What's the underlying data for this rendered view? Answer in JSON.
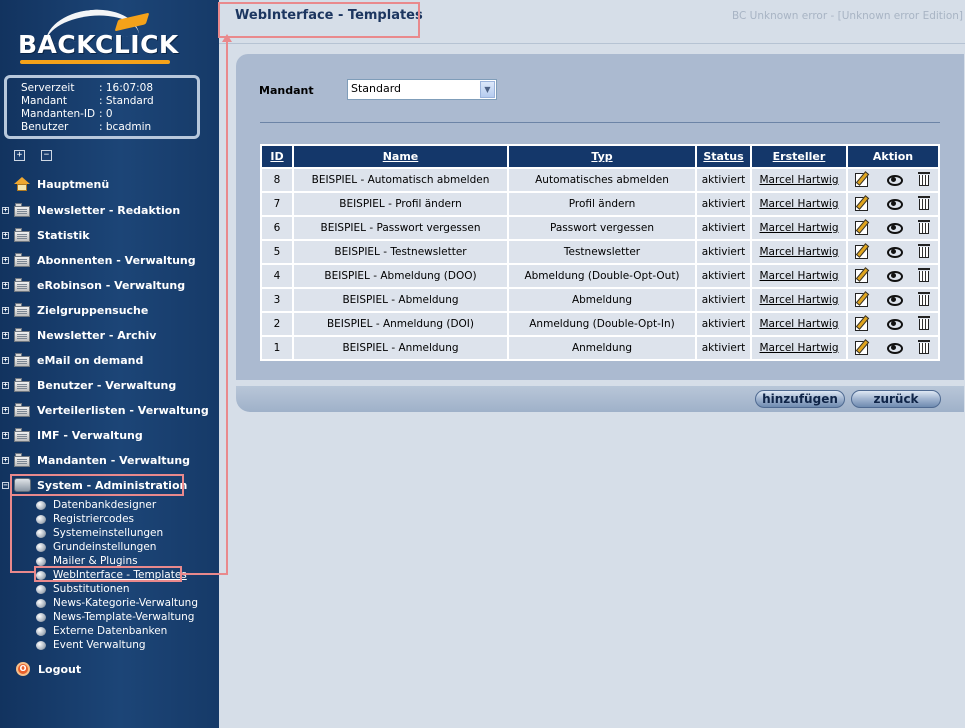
{
  "brand": {
    "logo_text": "BACKCLICK"
  },
  "info": [
    {
      "key": "Serverzeit",
      "value": ": 16:07:08"
    },
    {
      "key": "Mandant",
      "value": ": Standard"
    },
    {
      "key": "Mandanten-ID",
      "value": ": 0"
    },
    {
      "key": "Benutzer",
      "value": ": bcadmin"
    }
  ],
  "tree_controls": {
    "expand": "+",
    "collapse": "−"
  },
  "menu": {
    "home": "Hauptmenü",
    "items": [
      "Newsletter - Redaktion",
      "Statistik",
      "Abonnenten - Verwaltung",
      "eRobinson - Verwaltung",
      "Zielgruppensuche",
      "Newsletter - Archiv",
      "eMail on demand",
      "Benutzer - Verwaltung",
      "Verteilerlisten - Verwaltung",
      "IMF - Verwaltung",
      "Mandanten - Verwaltung"
    ],
    "system": "System - Administration",
    "sub": [
      "Datenbankdesigner",
      "Registriercodes",
      "Systemeinstellungen",
      "Grundeinstellungen",
      "Mailer & Plugins",
      "WebInterface - Templates",
      "Substitutionen",
      "News-Kategorie-Verwaltung",
      "News-Template-Verwaltung",
      "Externe Datenbanken",
      "Event Verwaltung"
    ],
    "logout": "Logout"
  },
  "header": {
    "title": "WebInterface - Templates",
    "edition": "BC Unknown error - [Unknown error Edition]"
  },
  "form": {
    "mandant_label": "Mandant",
    "mandant_value": "Standard"
  },
  "table": {
    "headers": {
      "id": "ID",
      "name": "Name",
      "typ": "Typ",
      "status": "Status",
      "ersteller": "Ersteller",
      "aktion": "Aktion"
    },
    "rows": [
      {
        "id": "8",
        "name": "BEISPIEL - Automatisch abmelden",
        "typ": "Automatisches abmelden",
        "status": "aktiviert",
        "ersteller": "Marcel Hartwig"
      },
      {
        "id": "7",
        "name": "BEISPIEL - Profil ändern",
        "typ": "Profil ändern",
        "status": "aktiviert",
        "ersteller": "Marcel Hartwig"
      },
      {
        "id": "6",
        "name": "BEISPIEL - Passwort vergessen",
        "typ": "Passwort vergessen",
        "status": "aktiviert",
        "ersteller": "Marcel Hartwig"
      },
      {
        "id": "5",
        "name": "BEISPIEL - Testnewsletter",
        "typ": "Testnewsletter",
        "status": "aktiviert",
        "ersteller": "Marcel Hartwig"
      },
      {
        "id": "4",
        "name": "BEISPIEL - Abmeldung (DOO)",
        "typ": "Abmeldung (Double-Opt-Out)",
        "status": "aktiviert",
        "ersteller": "Marcel Hartwig"
      },
      {
        "id": "3",
        "name": "BEISPIEL - Abmeldung",
        "typ": "Abmeldung",
        "status": "aktiviert",
        "ersteller": "Marcel Hartwig"
      },
      {
        "id": "2",
        "name": "BEISPIEL - Anmeldung (DOI)",
        "typ": "Anmeldung (Double-Opt-In)",
        "status": "aktiviert",
        "ersteller": "Marcel Hartwig"
      },
      {
        "id": "1",
        "name": "BEISPIEL - Anmeldung",
        "typ": "Anmeldung",
        "status": "aktiviert",
        "ersteller": "Marcel Hartwig"
      }
    ],
    "action_icons": [
      "edit-icon",
      "eye-icon",
      "trash-icon"
    ]
  },
  "buttons": {
    "add": "hinzufügen",
    "back": "zurück"
  },
  "colors": {
    "accent": "#f4a21a",
    "header_blue": "#14376a",
    "annotation": "#e9898c"
  }
}
